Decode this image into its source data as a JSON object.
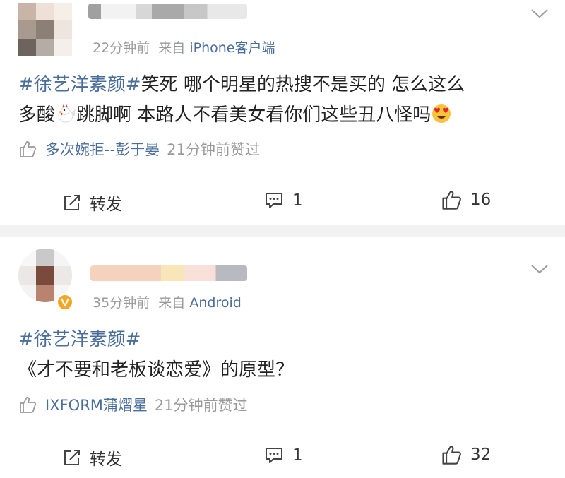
{
  "posts": [
    {
      "time": "22分钟前",
      "source_prefix": "来自",
      "source": "iPhone客户端",
      "hashtag": "#徐艺洋素颜#",
      "line1": "笑死 哪个明星的热搜不是买的 怎么这么",
      "line2a": "多酸",
      "line2b": "跳脚啊 本路人不看美女看你们这些丑八怪吗",
      "liked_by": "多次婉拒--彭于晏",
      "liked_time": "21分钟前赞过",
      "repost_label": "转发",
      "comment_count": "1",
      "like_count": "16"
    },
    {
      "time": "35分钟前",
      "source_prefix": "来自",
      "source": "Android",
      "hashtag": "#徐艺洋素颜#",
      "line1": "《才不要和老板谈恋爱》的原型？",
      "liked_by": "IXFORM蒲熠星",
      "liked_time": "21分钟前赞过",
      "repost_label": "转发",
      "comment_count": "1",
      "like_count": "32"
    }
  ],
  "icons": {
    "repost": "repost-icon",
    "comment": "comment-icon",
    "like": "like-icon",
    "chevron": "chevron-down-icon",
    "verified": "verified-badge-icon",
    "chicken": "chicken-emoji",
    "heart_eyes": "heart-eyes-emoji"
  },
  "colors": {
    "link": "#4a6e9c",
    "muted": "#9a9a9a",
    "text": "#222222",
    "separator": "#f2f2f2",
    "verified": "#f5a623"
  }
}
